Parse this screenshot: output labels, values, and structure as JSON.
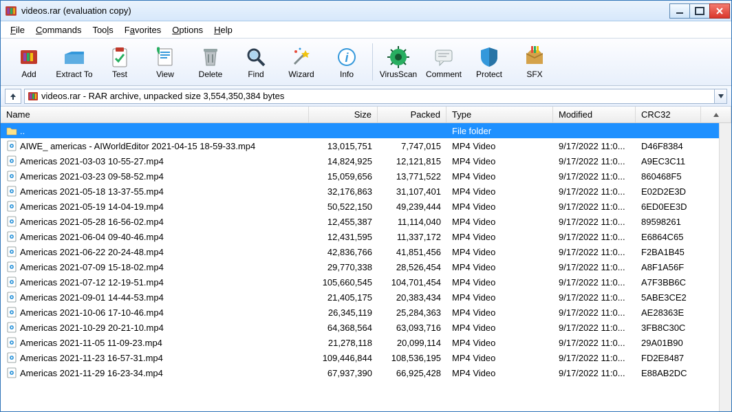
{
  "title": "videos.rar (evaluation copy)",
  "menu": {
    "file": "File",
    "commands": "Commands",
    "tools": "Tools",
    "favorites": "Favorites",
    "options": "Options",
    "help": "Help"
  },
  "toolbar": {
    "add": "Add",
    "extract": "Extract To",
    "test": "Test",
    "view": "View",
    "delete": "Delete",
    "find": "Find",
    "wizard": "Wizard",
    "info": "Info",
    "virus": "VirusScan",
    "comment": "Comment",
    "protect": "Protect",
    "sfx": "SFX"
  },
  "address": "videos.rar - RAR archive, unpacked size 3,554,350,384 bytes",
  "headers": {
    "name": "Name",
    "size": "Size",
    "packed": "Packed",
    "type": "Type",
    "modified": "Modified",
    "crc": "CRC32"
  },
  "parent": {
    "name": "..",
    "type": "File folder"
  },
  "rows": [
    {
      "name": "AIWE_ americas - AIWorldEditor 2021-04-15 18-59-33.mp4",
      "size": "13,015,751",
      "packed": "7,747,015",
      "type": "MP4 Video",
      "modified": "9/17/2022 11:0...",
      "crc": "D46F8384"
    },
    {
      "name": "Americas 2021-03-03 10-55-27.mp4",
      "size": "14,824,925",
      "packed": "12,121,815",
      "type": "MP4 Video",
      "modified": "9/17/2022 11:0...",
      "crc": "A9EC3C11"
    },
    {
      "name": "Americas 2021-03-23 09-58-52.mp4",
      "size": "15,059,656",
      "packed": "13,771,522",
      "type": "MP4 Video",
      "modified": "9/17/2022 11:0...",
      "crc": "860468F5"
    },
    {
      "name": "Americas 2021-05-18 13-37-55.mp4",
      "size": "32,176,863",
      "packed": "31,107,401",
      "type": "MP4 Video",
      "modified": "9/17/2022 11:0...",
      "crc": "E02D2E3D"
    },
    {
      "name": "Americas 2021-05-19 14-04-19.mp4",
      "size": "50,522,150",
      "packed": "49,239,444",
      "type": "MP4 Video",
      "modified": "9/17/2022 11:0...",
      "crc": "6ED0EE3D"
    },
    {
      "name": "Americas 2021-05-28 16-56-02.mp4",
      "size": "12,455,387",
      "packed": "11,114,040",
      "type": "MP4 Video",
      "modified": "9/17/2022 11:0...",
      "crc": "89598261"
    },
    {
      "name": "Americas 2021-06-04 09-40-46.mp4",
      "size": "12,431,595",
      "packed": "11,337,172",
      "type": "MP4 Video",
      "modified": "9/17/2022 11:0...",
      "crc": "E6864C65"
    },
    {
      "name": "Americas 2021-06-22 20-24-48.mp4",
      "size": "42,836,766",
      "packed": "41,851,456",
      "type": "MP4 Video",
      "modified": "9/17/2022 11:0...",
      "crc": "F2BA1B45"
    },
    {
      "name": "Americas 2021-07-09 15-18-02.mp4",
      "size": "29,770,338",
      "packed": "28,526,454",
      "type": "MP4 Video",
      "modified": "9/17/2022 11:0...",
      "crc": "A8F1A56F"
    },
    {
      "name": "Americas 2021-07-12 12-19-51.mp4",
      "size": "105,660,545",
      "packed": "104,701,454",
      "type": "MP4 Video",
      "modified": "9/17/2022 11:0...",
      "crc": "A7F3BB6C"
    },
    {
      "name": "Americas 2021-09-01 14-44-53.mp4",
      "size": "21,405,175",
      "packed": "20,383,434",
      "type": "MP4 Video",
      "modified": "9/17/2022 11:0...",
      "crc": "5ABE3CE2"
    },
    {
      "name": "Americas 2021-10-06 17-10-46.mp4",
      "size": "26,345,119",
      "packed": "25,284,363",
      "type": "MP4 Video",
      "modified": "9/17/2022 11:0...",
      "crc": "AE28363E"
    },
    {
      "name": "Americas 2021-10-29 20-21-10.mp4",
      "size": "64,368,564",
      "packed": "63,093,716",
      "type": "MP4 Video",
      "modified": "9/17/2022 11:0...",
      "crc": "3FB8C30C"
    },
    {
      "name": "Americas 2021-11-05 11-09-23.mp4",
      "size": "21,278,118",
      "packed": "20,099,114",
      "type": "MP4 Video",
      "modified": "9/17/2022 11:0...",
      "crc": "29A01B90"
    },
    {
      "name": "Americas 2021-11-23 16-57-31.mp4",
      "size": "109,446,844",
      "packed": "108,536,195",
      "type": "MP4 Video",
      "modified": "9/17/2022 11:0...",
      "crc": "FD2E8487"
    },
    {
      "name": "Americas 2021-11-29 16-23-34.mp4",
      "size": "67,937,390",
      "packed": "66,925,428",
      "type": "MP4 Video",
      "modified": "9/17/2022 11:0...",
      "crc": "E88AB2DC"
    }
  ]
}
